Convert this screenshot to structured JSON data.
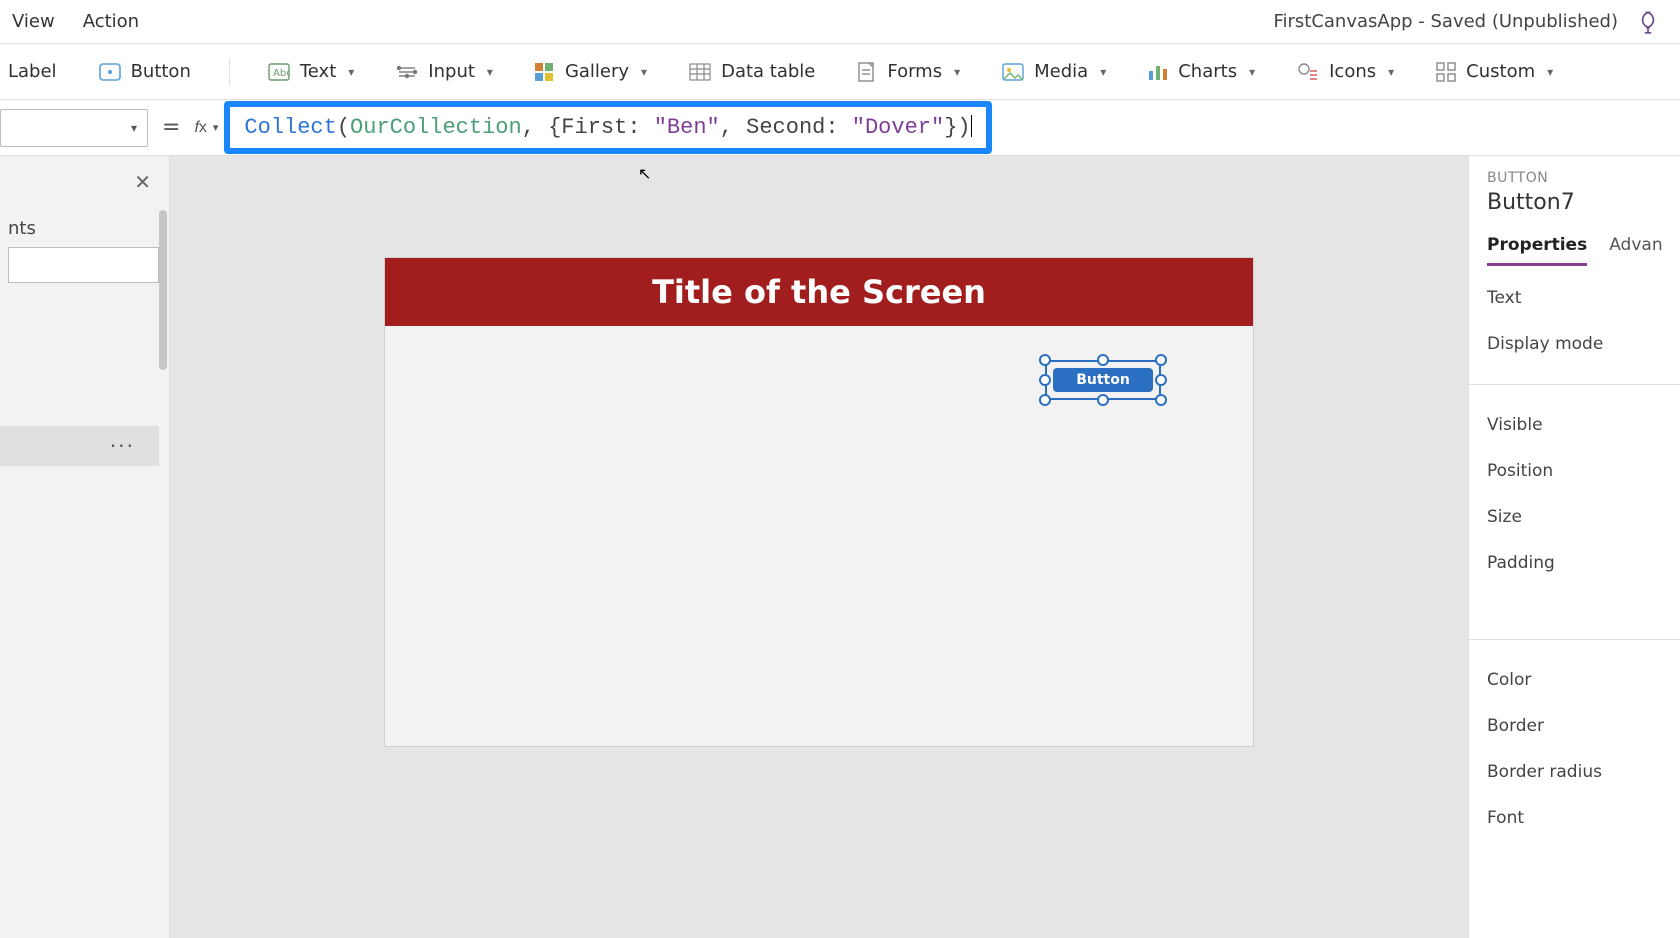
{
  "menubar": {
    "items": [
      "View",
      "Action"
    ],
    "app_status": "FirstCanvasApp - Saved (Unpublished)"
  },
  "ribbon": {
    "label": "Label",
    "button": "Button",
    "text": "Text",
    "input": "Input",
    "gallery": "Gallery",
    "data_table": "Data table",
    "forms": "Forms",
    "media": "Media",
    "charts": "Charts",
    "icons": "Icons",
    "custom": "Custom"
  },
  "formula": {
    "fn": "Collect",
    "collection": "OurCollection",
    "key1": "First",
    "val1": "\"Ben\"",
    "key2": "Second",
    "val2": "\"Dover\""
  },
  "left_panel": {
    "header_suffix": "nts",
    "selected_row_more": "···"
  },
  "canvas": {
    "screen_title": "Title of the Screen",
    "selected_button_label": "Button"
  },
  "right_panel": {
    "type": "BUTTON",
    "name": "Button7",
    "tabs": {
      "properties": "Properties",
      "advanced": "Advan"
    },
    "props": {
      "text": "Text",
      "display_mode": "Display mode",
      "visible": "Visible",
      "position": "Position",
      "size": "Size",
      "padding": "Padding",
      "color": "Color",
      "border": "Border",
      "border_radius": "Border radius",
      "font": "Font"
    }
  }
}
